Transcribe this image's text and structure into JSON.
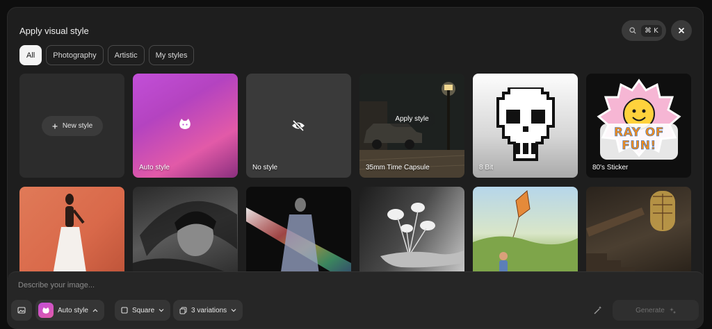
{
  "header": {
    "title": "Apply visual style",
    "shortcut": "⌘ K",
    "search_icon": "search-icon",
    "close_icon": "close-icon"
  },
  "filters": [
    {
      "label": "All",
      "active": true
    },
    {
      "label": "Photography",
      "active": false
    },
    {
      "label": "Artistic",
      "active": false
    },
    {
      "label": "My styles",
      "active": false
    }
  ],
  "cards_row1": [
    {
      "label": "",
      "button": "New style"
    },
    {
      "label": "Auto style",
      "icon": "sparkle-cat-icon"
    },
    {
      "label": "No style",
      "icon": "eye-off-icon"
    },
    {
      "label": "35mm Time Capsule",
      "overlay": "Apply style"
    },
    {
      "label": "8 Bit"
    },
    {
      "label": "80's Sticker",
      "sticker_text": "RAY OF FUN!"
    }
  ],
  "cards_row2": [
    {
      "label": ""
    },
    {
      "label": ""
    },
    {
      "label": ""
    },
    {
      "label": ""
    },
    {
      "label": ""
    },
    {
      "label": ""
    }
  ],
  "composer": {
    "placeholder": "Describe your image...",
    "style_button": "Auto style",
    "aspect_button": "Square",
    "variations_button": "3 variations",
    "generate_button": "Generate"
  }
}
